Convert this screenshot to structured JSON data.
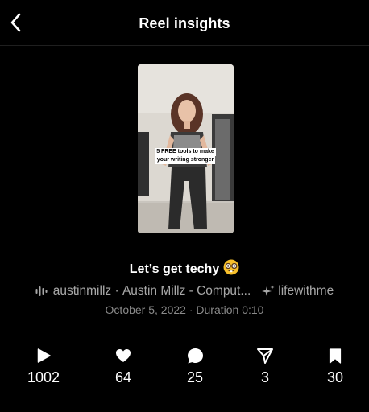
{
  "header": {
    "title": "Reel insights"
  },
  "reel": {
    "overlay_line1": "5  FREE tools to make",
    "overlay_line2": "your writing stronger",
    "caption": "Let’s get techy",
    "caption_emoji": "nerd-face-emoji"
  },
  "meta": {
    "audio_user": "austinmillz",
    "separator": "·",
    "audio_title": "Austin Millz - Comput...",
    "collab_tag": "lifewithme",
    "date": "October 5, 2022",
    "duration": "Duration 0:10",
    "date_line": "October 5, 2022 · Duration 0:10"
  },
  "stats": [
    {
      "icon": "play-icon",
      "value": "1002"
    },
    {
      "icon": "heart-icon",
      "value": "64"
    },
    {
      "icon": "comment-icon",
      "value": "25"
    },
    {
      "icon": "share-icon",
      "value": "3"
    },
    {
      "icon": "bookmark-icon",
      "value": "30"
    }
  ],
  "colors": {
    "background": "#000000",
    "primary_text": "#ffffff",
    "secondary_text": "#a8a8a8",
    "divider": "#1f1f1f"
  }
}
